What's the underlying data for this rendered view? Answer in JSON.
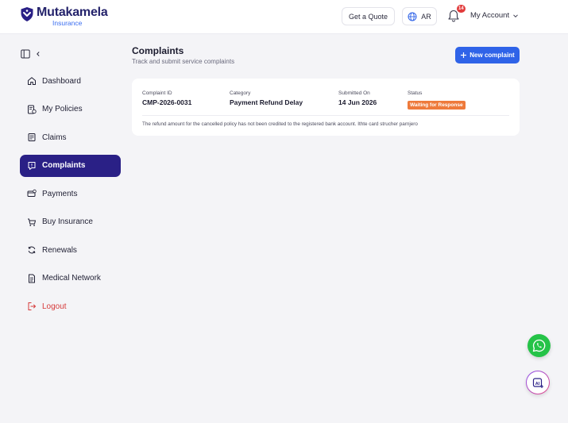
{
  "header": {
    "logo_name": "Mutakamela",
    "logo_sub": "Insurance",
    "get_quote": "Get a Quote",
    "language": "AR",
    "notification_count": "14",
    "account": "My Account"
  },
  "sidebar": {
    "items": [
      {
        "label": "Dashboard",
        "icon": "home-icon"
      },
      {
        "label": "My Policies",
        "icon": "policies-icon"
      },
      {
        "label": "Claims",
        "icon": "claims-icon"
      },
      {
        "label": "Complaints",
        "icon": "complaints-icon",
        "active": true
      },
      {
        "label": "Payments",
        "icon": "payments-icon"
      },
      {
        "label": "Buy Insurance",
        "icon": "cart-icon"
      },
      {
        "label": "Renewals",
        "icon": "refresh-icon"
      },
      {
        "label": "Medical Network",
        "icon": "document-icon"
      },
      {
        "label": "Logout",
        "icon": "logout-icon"
      }
    ]
  },
  "main": {
    "title": "Complaints",
    "subtitle": "Track and submit service complaints",
    "new_button": "New complaint",
    "complaint": {
      "id_label": "Complaint ID",
      "id_value": "CMP-2026-0031",
      "category_label": "Category",
      "category_value": "Payment Refund Delay",
      "submitted_label": "Submitted On",
      "submitted_value": "14 Jun 2026",
      "status_label": "Status",
      "status_value": "Waiting for Response",
      "description": "The refund amount for the cancelled policy has not been credited to the registered bank account. Ithte card strucher parnjero"
    }
  },
  "colors": {
    "brand": "#2a2086",
    "primary_button": "#2f63e8",
    "status_waiting": "#ee7a3b",
    "logout": "#d63a3a",
    "whatsapp": "#25c348"
  }
}
